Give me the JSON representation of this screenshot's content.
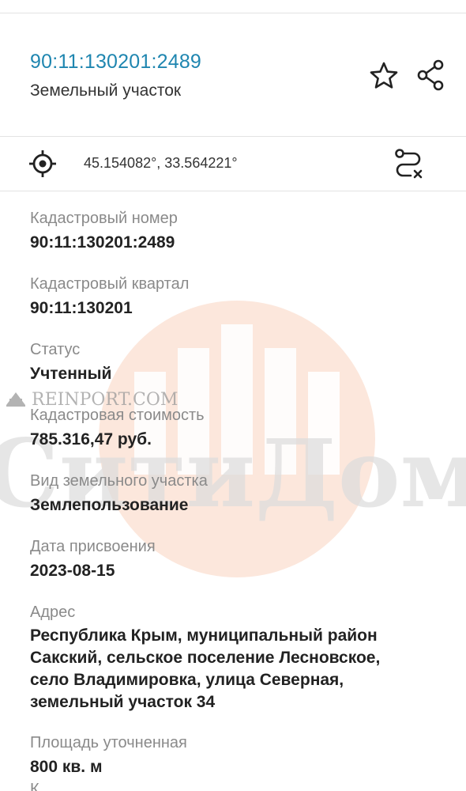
{
  "header": {
    "title": "90:11:130201:2489",
    "subtitle": "Земельный участок",
    "icons": {
      "favorite": "star-outline-icon",
      "share": "share-icon"
    }
  },
  "coordinates": {
    "text": "45.154082°, 33.564221°",
    "icons": {
      "locate": "crosshair-icon",
      "route": "route-off-icon"
    }
  },
  "fields": [
    {
      "label": "Кадастровый номер",
      "value": "90:11:130201:2489"
    },
    {
      "label": "Кадастровый квартал",
      "value": "90:11:130201"
    },
    {
      "label": "Статус",
      "value": "Учтенный"
    },
    {
      "label": "Кадастровая стоимость",
      "value": "785.316,47 руб."
    },
    {
      "label": "Вид земельного участка",
      "value": "Землепользование"
    },
    {
      "label": "Дата присвоения",
      "value": "2023-08-15"
    },
    {
      "label": "Адрес",
      "value": "Республика Крым, муниципальный район\nСакский, сельское поселение Лесновское,\nсело Владимировка, улица Северная,\nземельный участок 34"
    },
    {
      "label": "Площадь уточненная",
      "value": "800 кв. м"
    }
  ],
  "next_label_partial": "К",
  "watermark": {
    "site": "REINPORT.COM",
    "brand": "СитиДом",
    "brand_color": "#f6b89a"
  },
  "colors": {
    "accent": "#1f86b0",
    "label": "#8a8a8a",
    "value": "#222222",
    "divider": "#e3e3e3"
  }
}
